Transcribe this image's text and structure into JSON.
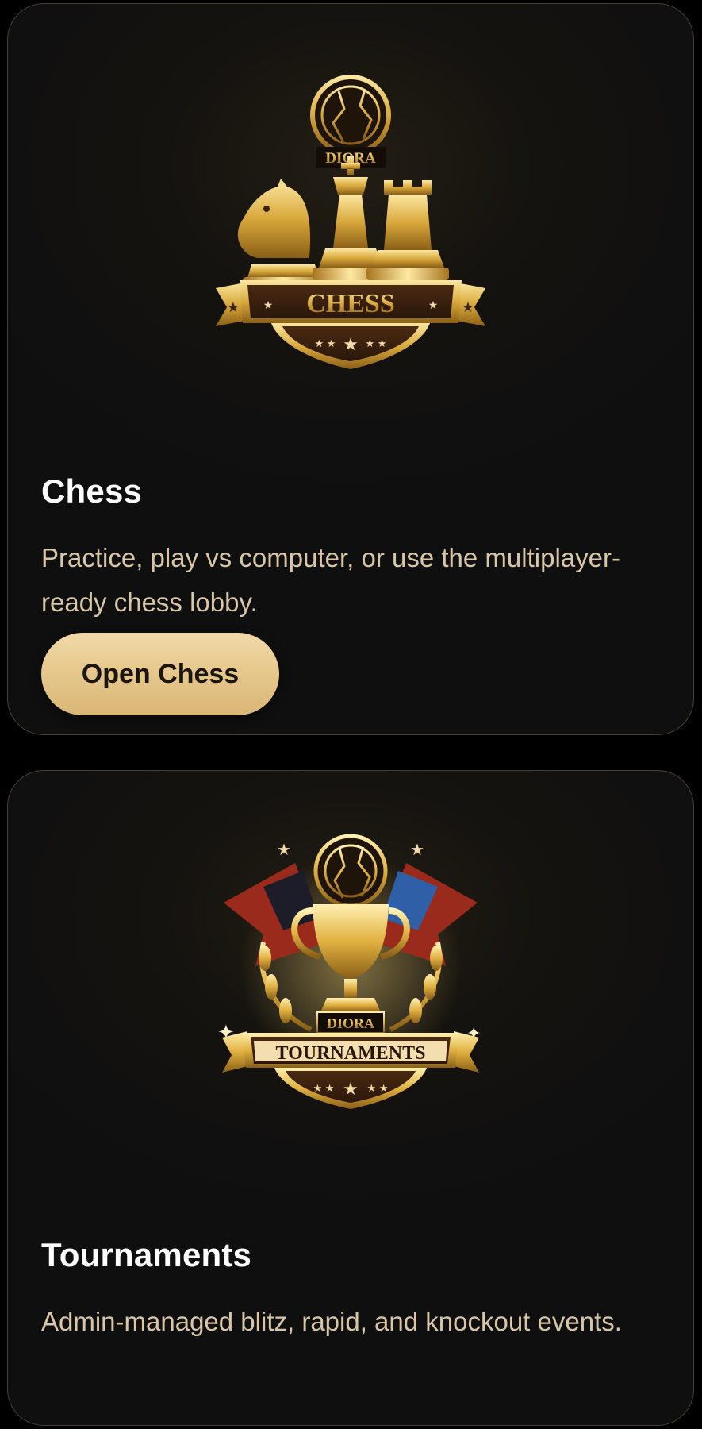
{
  "cards": [
    {
      "logo_icon": "chess-logo-icon",
      "logo_top_text": "DIORA",
      "logo_banner_text": "CHESS",
      "title": "Chess",
      "description": "Practice, play vs computer, or use the multiplayer-ready chess lobby.",
      "button_label": "Open Chess"
    },
    {
      "logo_icon": "tournaments-logo-icon",
      "logo_top_text": "DIORA",
      "logo_banner_text": "TOURNAMENTS",
      "title": "Tournaments",
      "description": "Admin-managed blitz, rapid, and knockout events."
    }
  ],
  "colors": {
    "page_background": "#000000",
    "card_border": "#4a4030",
    "gold": "#d9a93c",
    "button_gradient_top": "#f1d9a7",
    "button_gradient_bottom": "#d9b676",
    "title_text": "#ffffff",
    "description_text": "#d8c6a6",
    "ribbon_red": "#9a2a1c",
    "ribbon_blue": "#2f5fa6"
  }
}
